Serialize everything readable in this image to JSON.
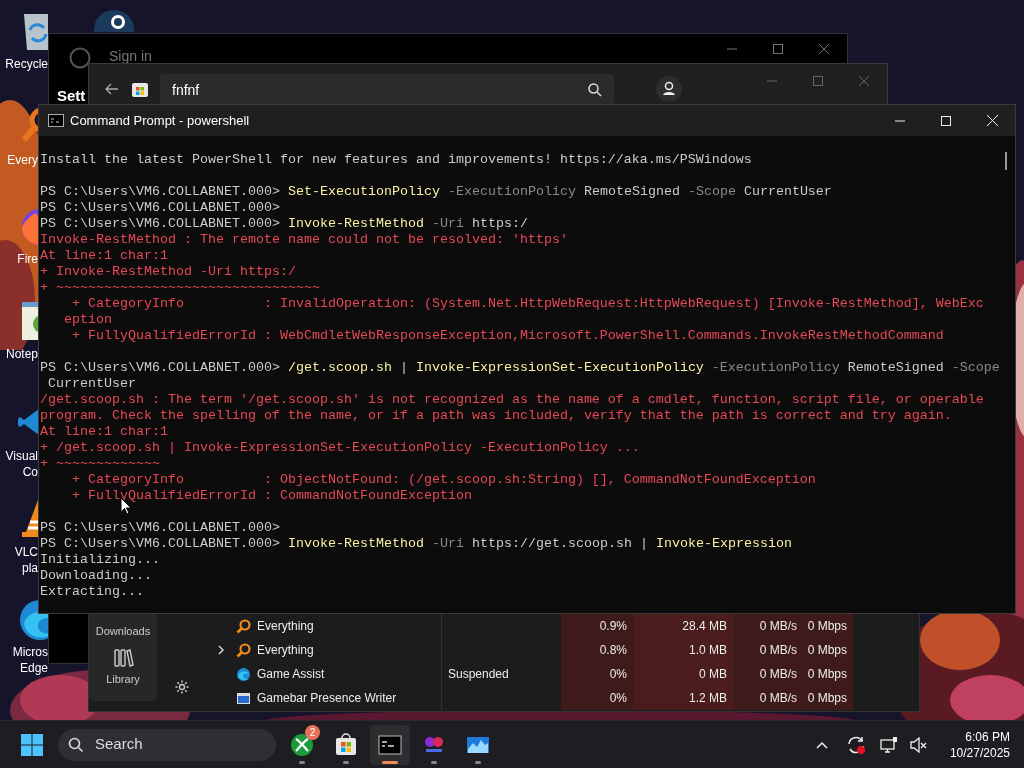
{
  "desktop_icons": [
    {
      "kind": "recycle-bin",
      "labels": [
        "Recycle"
      ]
    },
    {
      "kind": "steam"
    },
    {
      "kind": "everything",
      "labels": [
        "Every"
      ]
    },
    {
      "kind": "firefox",
      "labels": [
        "Fire"
      ]
    },
    {
      "kind": "notepad",
      "labels": [
        "Notep"
      ]
    },
    {
      "kind": "vscode",
      "labels": [
        "Visual",
        "Co"
      ]
    },
    {
      "kind": "vlc",
      "labels": [
        "VLC",
        "pla"
      ]
    },
    {
      "kind": "edge",
      "labels": [
        "Micros",
        "Edge"
      ]
    }
  ],
  "settings_window": {
    "sign_in": "Sign in",
    "heading": "Sett"
  },
  "store_window": {
    "search": {
      "value": "fnfnf"
    }
  },
  "terminal": {
    "title": "Command Prompt - powershell",
    "blocks": [
      {
        "lines": [
          {
            "segments": [
              {
                "kind": "plain",
                "text": "Install the latest PowerShell for new features and improvements! https://aka.ms/PSWindows"
              }
            ]
          }
        ]
      },
      {
        "lines": [
          {
            "segments": [
              {
                "kind": "plain",
                "text": "PS C:\\Users\\VM6.COLLABNET.000> "
              },
              {
                "kind": "command",
                "text": "Set-ExecutionPolicy"
              },
              {
                "kind": "param",
                "text": " -ExecutionPolicy"
              },
              {
                "kind": "plain",
                "text": " RemoteSigned"
              },
              {
                "kind": "param",
                "text": " -Scope"
              },
              {
                "kind": "plain",
                "text": " CurrentUser"
              }
            ]
          },
          {
            "segments": [
              {
                "kind": "plain",
                "text": "PS C:\\Users\\VM6.COLLABNET.000>"
              }
            ]
          },
          {
            "segments": [
              {
                "kind": "plain",
                "text": "PS C:\\Users\\VM6.COLLABNET.000> "
              },
              {
                "kind": "command",
                "text": "Invoke-RestMethod"
              },
              {
                "kind": "param",
                "text": " -Uri"
              },
              {
                "kind": "plain",
                "text": " https:/"
              }
            ]
          },
          {
            "segments": [
              {
                "kind": "error",
                "text": "Invoke-RestMethod : The remote name could not be resolved: 'https'"
              }
            ]
          },
          {
            "segments": [
              {
                "kind": "error",
                "text": "At line:1 char:1"
              }
            ]
          },
          {
            "segments": [
              {
                "kind": "error",
                "text": "+ Invoke-RestMethod -Uri https:/"
              }
            ]
          },
          {
            "segments": [
              {
                "kind": "error",
                "text": "+ ~~~~~~~~~~~~~~~~~~~~~~~~~~~~~~~~~"
              }
            ]
          },
          {
            "segments": [
              {
                "kind": "error",
                "text": "    + CategoryInfo          : InvalidOperation: (System.Net.HttpWebRequest:HttpWebRequest) [Invoke-RestMethod], WebExc"
              }
            ]
          },
          {
            "segments": [
              {
                "kind": "error",
                "text": "   eption"
              }
            ]
          },
          {
            "segments": [
              {
                "kind": "error",
                "text": "    + FullyQualifiedErrorId : WebCmdletWebResponseException,Microsoft.PowerShell.Commands.InvokeRestMethodCommand"
              }
            ]
          }
        ]
      },
      {
        "lines": [
          {
            "segments": [
              {
                "kind": "plain",
                "text": "PS C:\\Users\\VM6.COLLABNET.000> "
              },
              {
                "kind": "command",
                "text": "/get.scoop.sh"
              },
              {
                "kind": "plain",
                "text": " | "
              },
              {
                "kind": "command",
                "text": "Invoke-ExpressionSet-ExecutionPolicy"
              },
              {
                "kind": "param",
                "text": " -ExecutionPolicy"
              },
              {
                "kind": "plain",
                "text": " RemoteSigned"
              },
              {
                "kind": "param",
                "text": " -Scope"
              }
            ]
          },
          {
            "segments": [
              {
                "kind": "plain",
                "text": " CurrentUser"
              }
            ]
          },
          {
            "segments": [
              {
                "kind": "error",
                "text": "/get.scoop.sh : The term '/get.scoop.sh' is not recognized as the name of a cmdlet, function, script file, or operable"
              }
            ]
          },
          {
            "segments": [
              {
                "kind": "error",
                "text": "program. Check the spelling of the name, or if a path was included, verify that the path is correct and try again."
              }
            ]
          },
          {
            "segments": [
              {
                "kind": "error",
                "text": "At line:1 char:1"
              }
            ]
          },
          {
            "segments": [
              {
                "kind": "error",
                "text": "+ /get.scoop.sh | Invoke-ExpressionSet-ExecutionPolicy -ExecutionPolicy ..."
              }
            ]
          },
          {
            "segments": [
              {
                "kind": "error",
                "text": "+ ~~~~~~~~~~~~~"
              }
            ]
          },
          {
            "segments": [
              {
                "kind": "error",
                "text": "    + CategoryInfo          : ObjectNotFound: (/get.scoop.sh:String) [], CommandNotFoundException"
              }
            ]
          },
          {
            "segments": [
              {
                "kind": "error",
                "text": "    + FullyQualifiedErrorId : CommandNotFoundException"
              }
            ]
          }
        ]
      },
      {
        "lines": [
          {
            "segments": [
              {
                "kind": "plain",
                "text": "PS C:\\Users\\VM6.COLLABNET.000>"
              }
            ]
          },
          {
            "segments": [
              {
                "kind": "plain",
                "text": "PS C:\\Users\\VM6.COLLABNET.000> "
              },
              {
                "kind": "command",
                "text": "Invoke-RestMethod"
              },
              {
                "kind": "param",
                "text": " -Uri"
              },
              {
                "kind": "plain",
                "text": " https://get.scoop.sh | "
              },
              {
                "kind": "command",
                "text": "Invoke-Expression"
              }
            ]
          },
          {
            "segments": [
              {
                "kind": "plain",
                "text": "Initializing..."
              }
            ]
          },
          {
            "segments": [
              {
                "kind": "plain",
                "text": "Downloading..."
              }
            ]
          },
          {
            "segments": [
              {
                "kind": "plain",
                "text": "Extracting..."
              }
            ]
          }
        ]
      }
    ]
  },
  "task_manager": {
    "nav": [
      {
        "label": "Downloads"
      },
      {
        "kind": "library",
        "label": "Library"
      }
    ],
    "rows": [
      {
        "kind": "search",
        "expandable": false,
        "name": "Everything",
        "cpu": "0.9%",
        "memory": "28.4 MB",
        "disk": "0 MB/s",
        "network": "0 Mbps"
      },
      {
        "kind": "search",
        "expandable": true,
        "name": "Everything",
        "cpu": "0.8%",
        "memory": "1.0 MB",
        "disk": "0 MB/s",
        "network": "0 Mbps"
      },
      {
        "kind": "edge",
        "expandable": false,
        "name": "Game Assist",
        "status": "Suspended",
        "cpu": "0%",
        "memory": "0 MB",
        "disk": "0 MB/s",
        "network": "0 Mbps"
      },
      {
        "kind": "window",
        "expandable": false,
        "name": "Gamebar Presence Writer",
        "cpu": "0%",
        "memory": "1.2 MB",
        "disk": "0 MB/s",
        "network": "0 Mbps"
      }
    ]
  },
  "taskbar": {
    "search_placeholder": "Search",
    "apps": [
      {
        "kind": "xbox",
        "badge": "2",
        "selected": false
      },
      {
        "kind": "store",
        "selected": false
      },
      {
        "kind": "terminal",
        "selected": true
      },
      {
        "kind": "game",
        "selected": false
      },
      {
        "kind": "monitor",
        "selected": false
      }
    ],
    "clock": {
      "time": "6:06 PM",
      "date": "10/27/2025"
    }
  }
}
